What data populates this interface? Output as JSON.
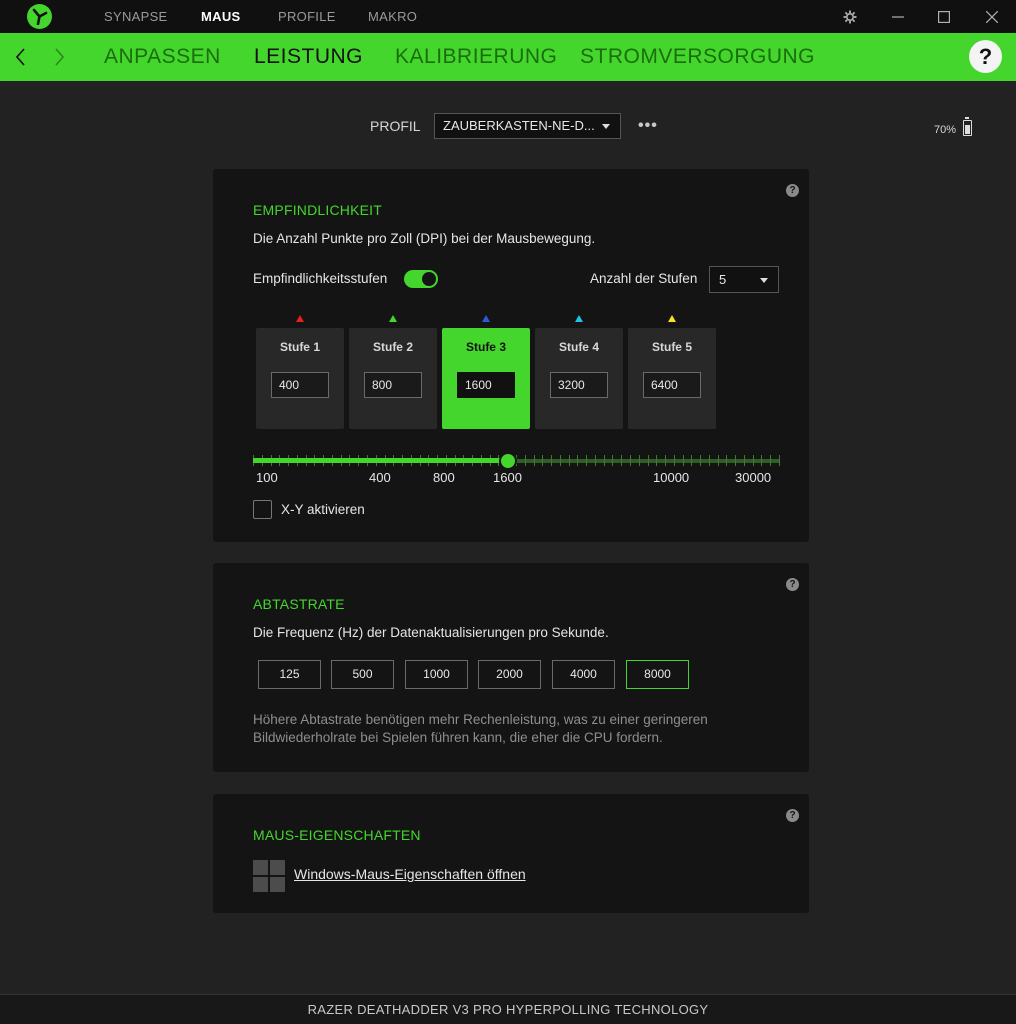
{
  "topbar": {
    "tabs": [
      {
        "label": "SYNAPSE",
        "active": false
      },
      {
        "label": "MAUS",
        "active": true
      },
      {
        "label": "PROFILE",
        "active": false
      },
      {
        "label": "MAKRO",
        "active": false
      }
    ],
    "icons": [
      "razer-logo-icon",
      "settings-icon",
      "minimize-icon",
      "maximize-icon",
      "close-icon"
    ]
  },
  "nav": {
    "tabs": [
      {
        "label": "ANPASSEN",
        "active": false
      },
      {
        "label": "LEISTUNG",
        "active": true
      },
      {
        "label": "KALIBRIERUNG",
        "active": false
      },
      {
        "label": "STROMVERSORGUNG",
        "active": false
      }
    ],
    "help": "?"
  },
  "profile": {
    "label": "PROFIL",
    "selected": "ZAUBERKASTEN-NE-D...",
    "more": "•••",
    "battery": "70%"
  },
  "sensitivity": {
    "title": "EMPFINDLICHKEIT",
    "description": "Die Anzahl Punkte pro Zoll (DPI) bei der Mausbewegung.",
    "toggle_label": "Empfindlichkeitsstufen",
    "toggle_on": true,
    "stages_label": "Anzahl der Stufen",
    "stages_count": "5",
    "stages": [
      {
        "name": "Stufe 1",
        "value": "400",
        "color": "#e8201c",
        "active": false
      },
      {
        "name": "Stufe 2",
        "value": "800",
        "color": "#44d62c",
        "active": false
      },
      {
        "name": "Stufe 3",
        "value": "1600",
        "color": "#2a5bd8",
        "active": true
      },
      {
        "name": "Stufe 4",
        "value": "3200",
        "color": "#1ec6e6",
        "active": false
      },
      {
        "name": "Stufe 5",
        "value": "6400",
        "color": "#f2e51c",
        "active": false
      }
    ],
    "slider_labels": [
      "100",
      "400",
      "800",
      "1600",
      "10000",
      "30000"
    ],
    "slider_value": 1600,
    "xy_label": "X-Y aktivieren",
    "xy_checked": false
  },
  "polling": {
    "title": "ABTASTRATE",
    "description": "Die Frequenz (Hz) der Datenaktualisierungen pro Sekunde.",
    "rates": [
      "125",
      "500",
      "1000",
      "2000",
      "4000",
      "8000"
    ],
    "selected": "8000",
    "note": "Höhere Abtastrate benötigen mehr Rechenleistung, was zu einer geringeren Bildwiederholrate bei Spielen führen kann, die eher die CPU fordern."
  },
  "mouse_props": {
    "title": "MAUS-EIGENSCHAFTEN",
    "link": "Windows-Maus-Eigenschaften öffnen"
  },
  "footer": {
    "device": "RAZER DEATHADDER V3 PRO HYPERPOLLING TECHNOLOGY"
  },
  "colors": {
    "accent": "#44d62c",
    "background": "#222222",
    "panel": "#141414"
  }
}
